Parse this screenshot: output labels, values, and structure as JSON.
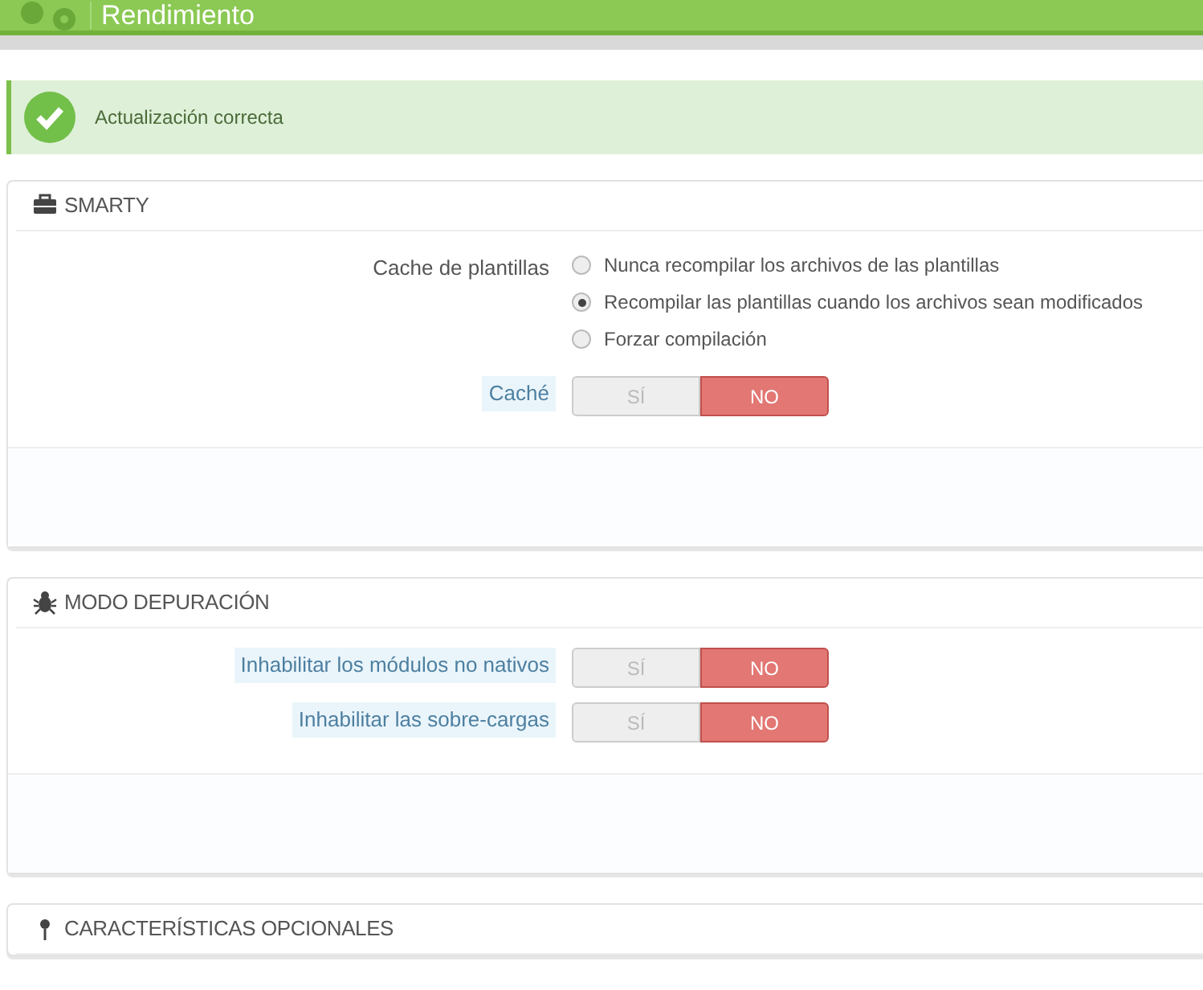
{
  "page_header": {
    "title": "Rendimiento"
  },
  "alert": {
    "text": "Actualización correcta"
  },
  "panels": [
    {
      "title": "SMARTY",
      "fields": [
        {
          "kind": "radio",
          "label": "Cache de plantillas",
          "help": false,
          "options": [
            {
              "label": "Nunca recompilar los archivos de las plantillas",
              "selected": false
            },
            {
              "label": "Recompilar las plantillas cuando los archivos sean modificados",
              "selected": true
            },
            {
              "label": "Forzar compilación",
              "selected": false
            }
          ]
        },
        {
          "kind": "switch",
          "label": "Caché",
          "help": true,
          "options": [
            {
              "label": "SÍ",
              "selected": false
            },
            {
              "label": "NO",
              "selected": true
            }
          ]
        }
      ]
    },
    {
      "title": "MODO DEPURACIÓN",
      "fields": [
        {
          "kind": "switch",
          "label": "Inhabilitar los módulos no nativos",
          "help": true,
          "options": [
            {
              "label": "SÍ",
              "selected": false
            },
            {
              "label": "NO",
              "selected": true
            }
          ]
        },
        {
          "kind": "switch",
          "label": "Inhabilitar las sobre-cargas",
          "help": true,
          "options": [
            {
              "label": "SÍ",
              "selected": false
            },
            {
              "label": "NO",
              "selected": true
            }
          ]
        }
      ]
    },
    {
      "title": "CARACTERÍSTICAS OPCIONALES"
    }
  ]
}
